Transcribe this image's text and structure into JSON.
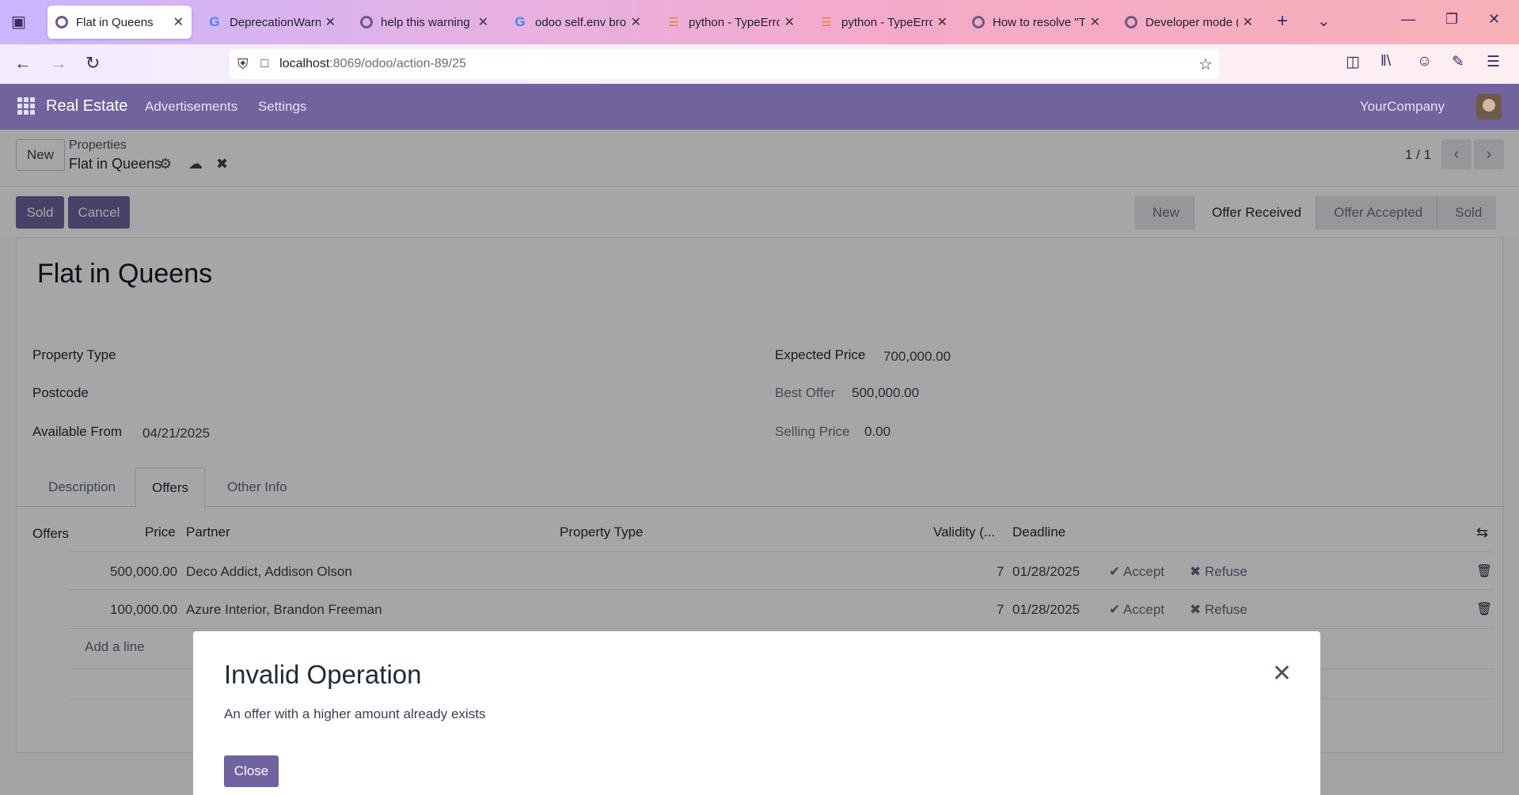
{
  "browser": {
    "tabs": [
      {
        "label": "Flat in Queens",
        "icon": "odoo-icon",
        "active": true
      },
      {
        "label": "DeprecationWarni",
        "icon": "google-icon"
      },
      {
        "label": "help this warning",
        "icon": "odoo-icon"
      },
      {
        "label": "odoo self.env brov",
        "icon": "google-icon"
      },
      {
        "label": "python - TypeError",
        "icon": "stackoverflow-icon"
      },
      {
        "label": "python - TypeError",
        "icon": "stackoverflow-icon"
      },
      {
        "label": "How to resolve \"Ty",
        "icon": "odoo-icon"
      },
      {
        "label": "Developer mode (",
        "icon": "odoo-icon"
      }
    ],
    "url_host": "localhost",
    "url_path": ":8069/odoo/action-89/25"
  },
  "app": {
    "brand": "Real Estate",
    "menu": [
      "Advertisements",
      "Settings"
    ],
    "company": "YourCompany"
  },
  "control_panel": {
    "new_label": "New",
    "breadcrumb_parent": "Properties",
    "breadcrumb_current": "Flat in Queens",
    "pager": "1 / 1"
  },
  "actions": {
    "sold": "Sold",
    "cancel": "Cancel"
  },
  "stages": [
    {
      "label": "New",
      "current": false
    },
    {
      "label": "Offer Received",
      "current": true
    },
    {
      "label": "Offer Accepted",
      "current": false
    },
    {
      "label": "Sold",
      "current": false
    }
  ],
  "record": {
    "title": "Flat in Queens",
    "property_type_label": "Property Type",
    "postcode_label": "Postcode",
    "available_from_label": "Available From",
    "available_from": "04/21/2025",
    "expected_price_label": "Expected Price",
    "expected_price": "700,000.00",
    "best_offer_label": "Best Offer",
    "best_offer": "500,000.00",
    "selling_price_label": "Selling Price",
    "selling_price": "0.00"
  },
  "form_tabs": [
    "Description",
    "Offers",
    "Other Info"
  ],
  "offers": {
    "label": "Offers",
    "headers": [
      "Price",
      "Partner",
      "Property Type",
      "Validity (...",
      "Deadline"
    ],
    "rows": [
      {
        "price": "500,000.00",
        "partner": "Deco Addict, Addison Olson",
        "validity": "7",
        "deadline": "01/28/2025"
      },
      {
        "price": "100,000.00",
        "partner": "Azure Interior, Brandon Freeman",
        "validity": "7",
        "deadline": "01/28/2025"
      }
    ],
    "accept": "Accept",
    "refuse": "Refuse",
    "add_line": "Add a line"
  },
  "dialog": {
    "title": "Invalid Operation",
    "message": "An offer with a higher amount already exists",
    "close": "Close"
  }
}
